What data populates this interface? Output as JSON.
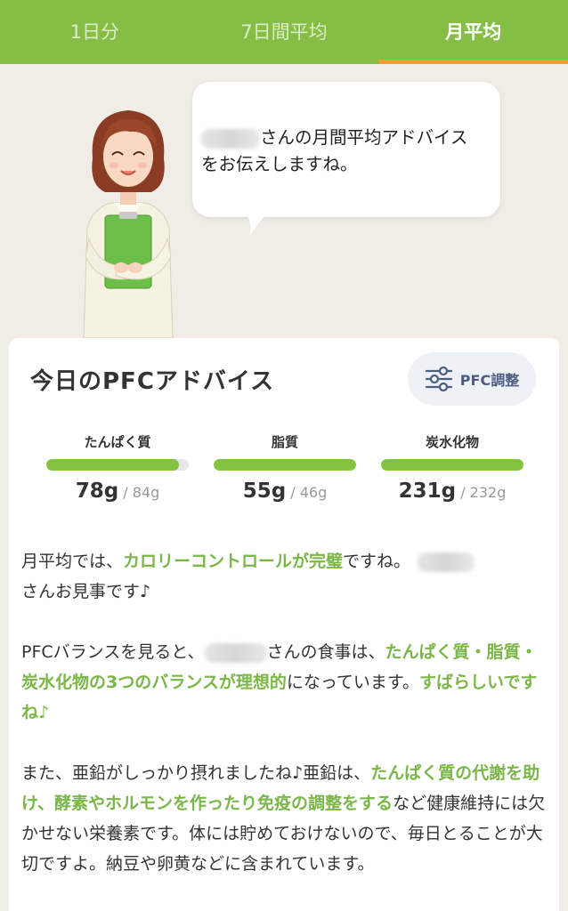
{
  "tabs": [
    {
      "label": "1日分",
      "active": false
    },
    {
      "label": "7日間平均",
      "active": false
    },
    {
      "label": "月平均",
      "active": true
    }
  ],
  "bubble": {
    "message_line1": "さんの月間平均アドバイス",
    "message_line2": "をお伝えしますね。"
  },
  "card": {
    "title": "今日のPFCアドバイス",
    "pfc_button_label": "PFC調整"
  },
  "nutrients": [
    {
      "label": "たんぱく質",
      "value": "78g",
      "target": "84g",
      "progress": 0.93
    },
    {
      "label": "脂質",
      "value": "55g",
      "target": "46g",
      "progress": 1.0
    },
    {
      "label": "炭水化物",
      "value": "231g",
      "target": "232g",
      "progress": 1.0
    }
  ],
  "advice": {
    "p1": {
      "t1": "月平均では、",
      "h1": "カロリーコントロールが完璧",
      "t2": "ですね。",
      "t3": "さんお見事です♪"
    },
    "p2": {
      "t1": "PFCバランスを見ると、",
      "t2": "さんの食事は、",
      "h1": "たんぱく質・脂質・炭水化物の3つのバランスが理想的",
      "t3": "になっています。",
      "h2": "すばらしいですね♪"
    },
    "p3": {
      "t1": "また、亜鉛がしっかり摂れましたね♪亜鉛は、",
      "h1": "たんぱく質の代謝を助け、酵素やホルモンを作ったり免疫の調整をする",
      "t2": "など健康維持には欠かせない栄養素です。体には貯めておけないので、毎日とることが大切ですよ。納豆や卵黄などに含まれています。"
    }
  },
  "colors": {
    "header_green": "#85bd45",
    "tab_indicator": "#f29b2e",
    "highlight_green": "#7ab648",
    "bar_green": "#83c340"
  }
}
